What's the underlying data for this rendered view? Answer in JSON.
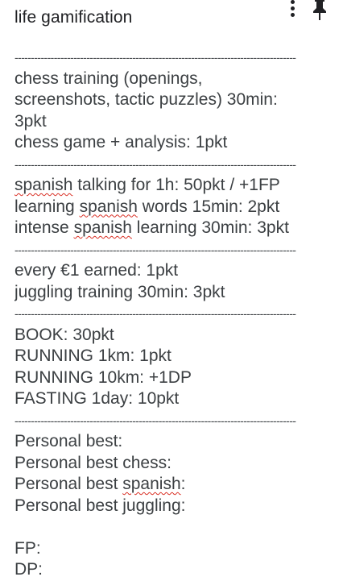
{
  "note": {
    "title": "life gamification",
    "divider": "--------------------------------------------------------------------------------------",
    "lines": {
      "chess_1": "chess training (openings,",
      "chess_2": "screenshots, tactic puzzles) 30min:",
      "chess_3": "3pkt",
      "chess_4": "chess game + analysis: 1pkt",
      "spanish_1_word": "spanish",
      "spanish_1_rest": " talking for 1h: 50pkt / +1FP",
      "spanish_2_pre": "learning ",
      "spanish_2_word": "spanish",
      "spanish_2_rest": " words 15min: 2pkt",
      "spanish_3_pre": "intense ",
      "spanish_3_word": "spanish",
      "spanish_3_rest": " learning 30min: 3pkt",
      "money": "every €1 earned: 1pkt",
      "juggling": "juggling training 30min: 3pkt",
      "book": "BOOK: 30pkt",
      "run_1": "RUNNING 1km: 1pkt",
      "run_10": "RUNNING 10km: +1DP",
      "fasting": "FASTING 1day: 10pkt",
      "pb": "Personal best:",
      "pb_chess": "Personal best chess:",
      "pb_spanish_pre": "Personal best ",
      "pb_spanish_word": "spanish",
      "pb_spanish_rest": ":",
      "pb_juggling": "Personal best juggling:",
      "fp": "FP:",
      "dp": "DP:"
    }
  },
  "icons": {
    "more": "more-vert-icon",
    "pin": "pin-icon"
  },
  "colors": {
    "text": "#202124",
    "spellcheck": "#d93025"
  }
}
